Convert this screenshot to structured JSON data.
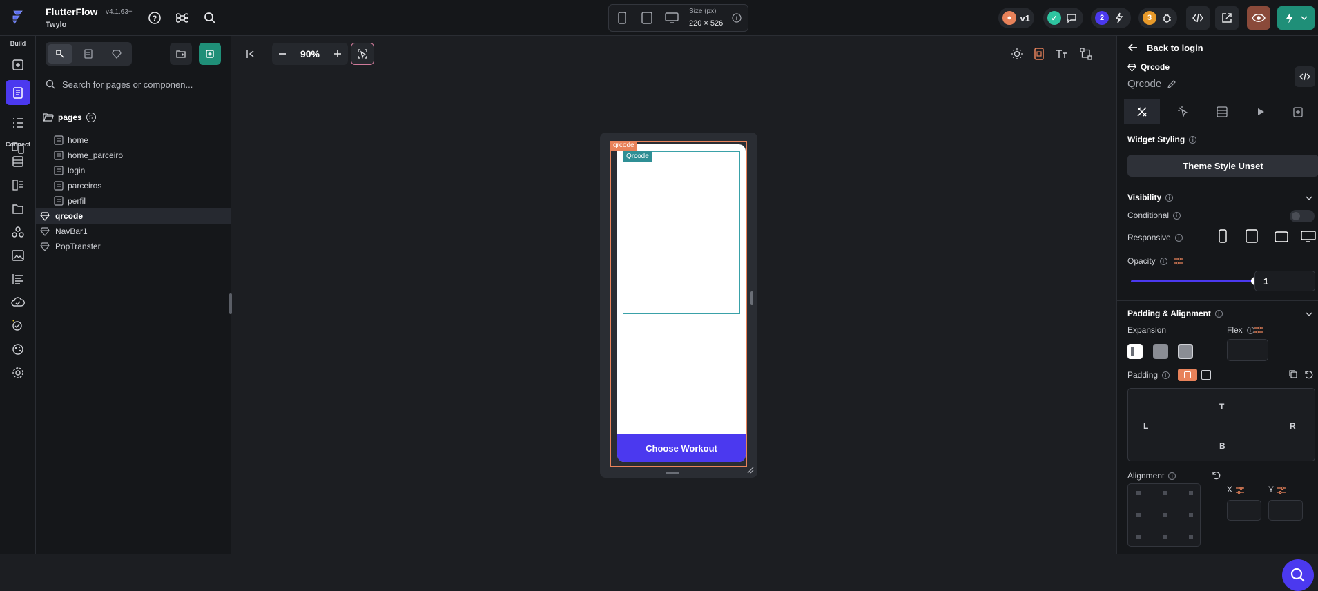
{
  "app": {
    "name": "FlutterFlow",
    "version": "v4.1.63+",
    "project": "Twylo"
  },
  "device": {
    "size_label": "Size (px)",
    "size_value": "220 × 526"
  },
  "topbar_right": {
    "version_badge": "v1",
    "notify_2": "2",
    "notify_3": "3"
  },
  "rail": {
    "build_label": "Build",
    "connect_label": "Connect"
  },
  "leftpanel": {
    "search_placeholder": "Search for pages or componen...",
    "pages_label": "pages",
    "pages_count": "5",
    "pages": [
      "home",
      "home_parceiro",
      "login",
      "parceiros",
      "perfil"
    ],
    "components": [
      "qrcode",
      "NavBar1",
      "PopTransfer"
    ]
  },
  "canvas": {
    "zoom": "90%",
    "selected_tag": "qrcode",
    "widget_tag": "Qrcode",
    "button_label": "Choose Workout"
  },
  "rightpanel": {
    "back_label": "Back to login",
    "component_name": "Qrcode",
    "widget_name": "Qrcode",
    "widget_styling": "Widget Styling",
    "theme_style": "Theme Style Unset",
    "visibility": "Visibility",
    "conditional": "Conditional",
    "responsive": "Responsive",
    "opacity": "Opacity",
    "opacity_value": "1",
    "padding_alignment": "Padding & Alignment",
    "expansion": "Expansion",
    "flex": "Flex",
    "padding": "Padding",
    "pad_t": "T",
    "pad_l": "L",
    "pad_r": "R",
    "pad_b": "B",
    "alignment": "Alignment",
    "x_label": "X",
    "y_label": "Y"
  },
  "colors": {
    "accent": "#4b39ef",
    "selection": "#e8825a",
    "widget_outline": "#3aa1a8"
  }
}
